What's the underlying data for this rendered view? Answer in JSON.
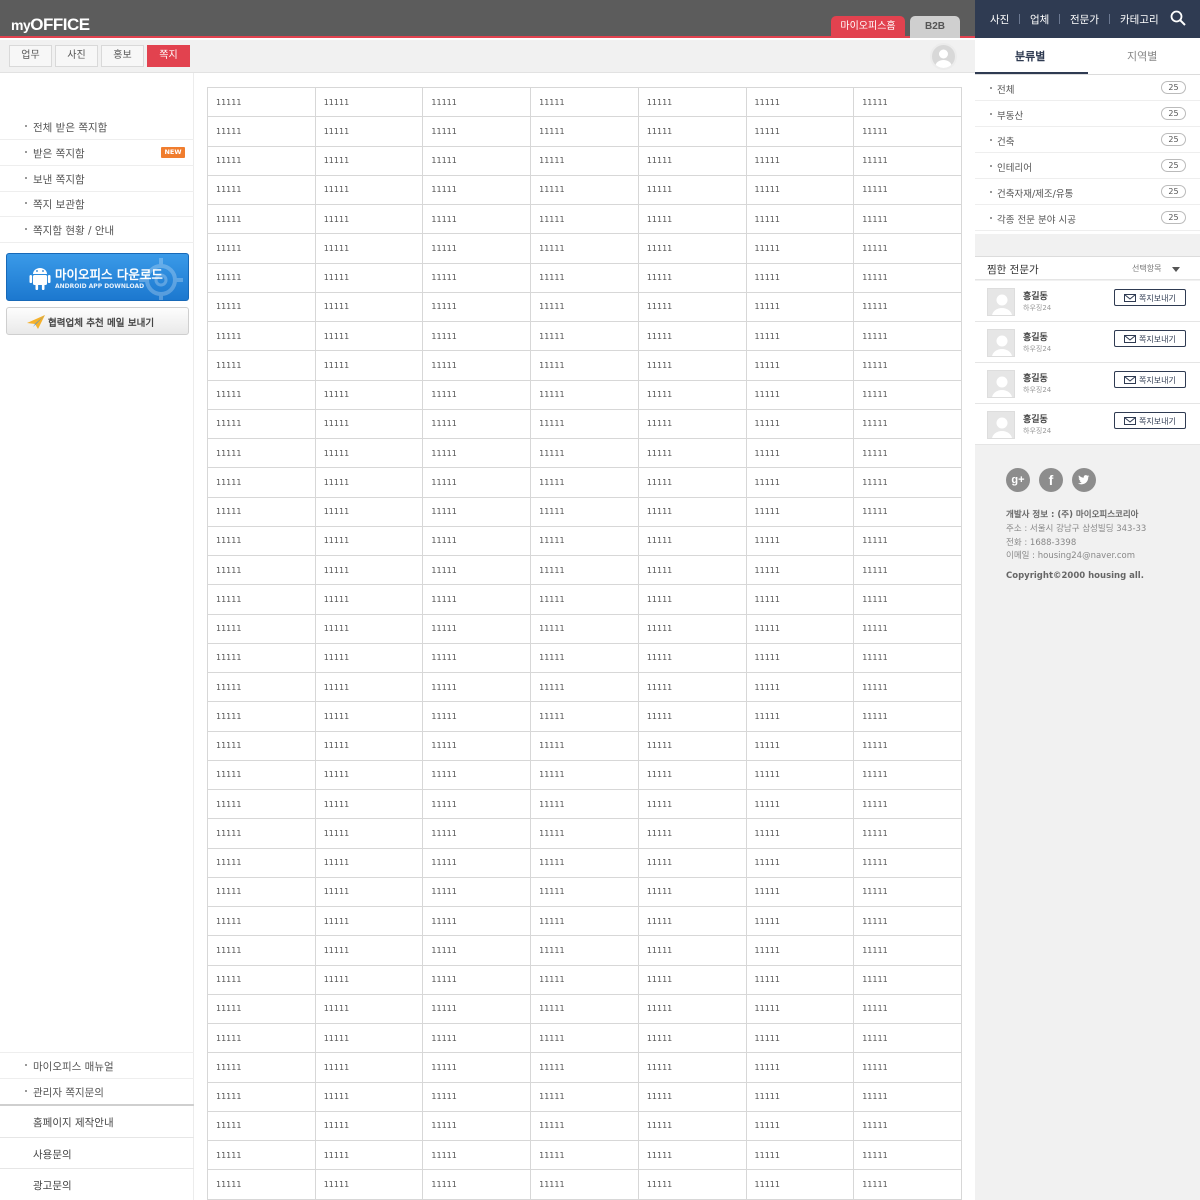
{
  "header": {
    "logo_my": "my",
    "logo_office": "OFFICE",
    "home_tab": "마이오피스홈",
    "b2b_tab": "B2B"
  },
  "topnav": {
    "items": [
      "사진",
      "업체",
      "전문가",
      "카테고리"
    ]
  },
  "subtabs": [
    {
      "label": "업무",
      "active": false
    },
    {
      "label": "사진",
      "active": false
    },
    {
      "label": "홍보",
      "active": false
    },
    {
      "label": "쪽지",
      "active": true
    }
  ],
  "left_menu": {
    "items": [
      "전체 받은 쪽지함",
      "받은 쪽지함",
      "보낸 쪽지함",
      "쪽지 보관함",
      "쪽지함 현황 / 안내"
    ],
    "new_badge": "NEW",
    "android_title": "마이오피스 다운로드",
    "android_sub": "ANDROID APP DOWNLOAD",
    "mail_button": "협력업체 추천 메일 보내기",
    "bottom_items": [
      "마이오피스 매뉴얼",
      "관리자 쪽지문의"
    ],
    "footer_items": [
      "홈페이지 제작안내",
      "사용문의",
      "광고문의"
    ]
  },
  "grid": {
    "columns": 7,
    "rows": 38,
    "cell_value": "11111"
  },
  "right_panel": {
    "tabs": [
      "분류별",
      "지역별"
    ],
    "categories": [
      {
        "label": "전체",
        "count": "25"
      },
      {
        "label": "부동산",
        "count": "25"
      },
      {
        "label": "건축",
        "count": "25"
      },
      {
        "label": "인테리어",
        "count": "25"
      },
      {
        "label": "건축자재/제조/유통",
        "count": "25"
      },
      {
        "label": "각종 전문 분야 시공",
        "count": "25"
      }
    ],
    "favorites_title": "찜한 전문가",
    "favorites_select": "선택항목",
    "favorites": [
      {
        "name": "홍길동",
        "company": "하우징24",
        "button": "쪽지보내기"
      },
      {
        "name": "홍길동",
        "company": "하우징24",
        "button": "쪽지보내기"
      },
      {
        "name": "홍길동",
        "company": "하우징24",
        "button": "쪽지보내기"
      },
      {
        "name": "홍길동",
        "company": "하우징24",
        "button": "쪽지보내기"
      }
    ],
    "social": [
      "g+",
      "f",
      "twitter-bird"
    ],
    "info": {
      "developer": "개발사 정보 : (주) 마이오피스코리아",
      "address": "주소 : 서울시 강남구 삼성빌딩 343-33",
      "phone": "전화 :  1688-3398",
      "email": "이메일 : housing24@naver.com",
      "copyright": "Copyright©2000 housing all."
    }
  },
  "colors": {
    "accent_red": "#e2424f",
    "navy": "#2f3b52",
    "topbar_gray": "#5c5c5c",
    "new_orange": "#f07d2e",
    "android_blue": "#1c78cf"
  }
}
